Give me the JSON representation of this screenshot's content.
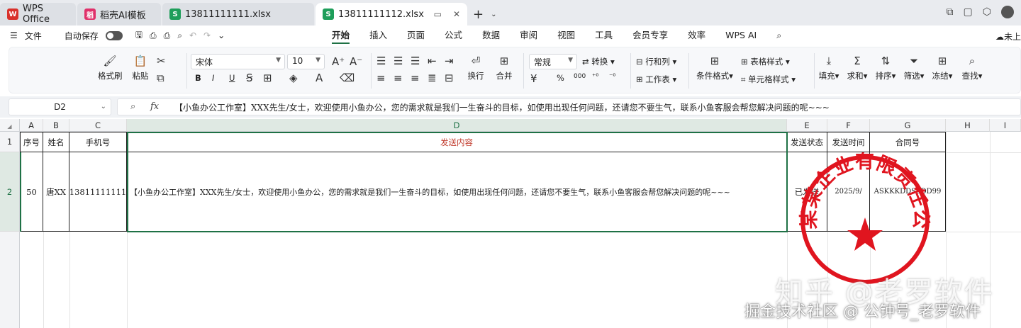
{
  "tabs": [
    {
      "label": "WPS Office",
      "icon": "wps-logo-icon",
      "color": "#d9312b"
    },
    {
      "label": "稻壳AI模板",
      "icon": "docer-icon",
      "color": "#e0306a"
    },
    {
      "label": "13811111111.xlsx",
      "icon": "sheet-icon",
      "color": "#1e9e5a"
    },
    {
      "label": "13811111112.xlsx",
      "icon": "sheet-icon",
      "color": "#1e9e5a",
      "active": true
    }
  ],
  "menubar": {
    "file": "文件",
    "autosave": "自动保存",
    "menus": [
      "开始",
      "插入",
      "页面",
      "公式",
      "数据",
      "审阅",
      "视图",
      "工具",
      "会员专享",
      "效率",
      "WPS AI"
    ],
    "active_menu": "开始",
    "right_label": "未上"
  },
  "ribbon": {
    "format_painter": "格式刷",
    "paste": "粘贴",
    "font_name": "宋体",
    "font_size": "10",
    "wrap": "换行",
    "merge": "合并",
    "number_format": "常规",
    "convert": "转换",
    "rows_cols": "行和列",
    "worksheet": "工作表",
    "cond_format": "条件格式",
    "table_style": "表格样式",
    "cell_style": "单元格样式",
    "fill": "填充",
    "sum": "求和",
    "sort": "排序",
    "filter": "筛选",
    "freeze": "冻结",
    "find": "查找",
    "bold": "B",
    "italic": "I",
    "underline": "U",
    "percent": "%",
    "thousands": "000"
  },
  "formula_bar": {
    "name_box": "D2",
    "fx": "fx",
    "content": "【小鱼办公工作室】XXX先生/女士，欢迎使用小鱼办公，您的需求就是我们一生奋斗的目标，如使用出现任何问题，还请您不要生气，联系小鱼客服会帮您解决问题的呢~~~"
  },
  "columns": [
    "A",
    "B",
    "C",
    "D",
    "E",
    "F",
    "G",
    "H",
    "I"
  ],
  "rows": [
    "1",
    "2"
  ],
  "headers": [
    "序号",
    "姓名",
    "手机号",
    "发送内容",
    "发送状态",
    "发送时间",
    "合同号"
  ],
  "row2": [
    "50",
    "唐XX",
    "13811111111",
    "【小鱼办公工作室】XXX先生/女士，欢迎使用小鱼办公，您的需求就是我们一生奋斗的目标，如使用出现任何问题，还请您不要生气，联系小鱼客服会帮您解决问题的呢~~~",
    "已发送",
    "2025/9/",
    "ASKKKDDSSDD99"
  ],
  "seal_text": "某某某企业有限责任公司",
  "watermark": {
    "line1": "知乎 @老罗软件",
    "line2": "掘金技术社区 @ 公钟号_老罗软件"
  },
  "colors": {
    "accent": "#1e7145",
    "seal": "#e0151f",
    "header_red": "#c0392b"
  }
}
